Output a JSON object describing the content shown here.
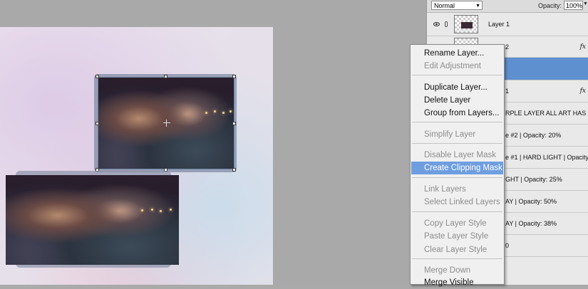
{
  "layers_panel": {
    "blend_mode": "Normal",
    "opacity_label": "Opacity:",
    "opacity_value": "100%",
    "layers": [
      {
        "name": "Layer 1",
        "fx": ""
      },
      {
        "name": "2",
        "fx": "fx"
      },
      {
        "name": "",
        "fx": ""
      },
      {
        "name": "1",
        "fx": "fx"
      },
      {
        "name": "RPLE LAYER ALL ART HAS",
        "fx": ""
      },
      {
        "name": "e #2 | Opacity: 20%",
        "fx": ""
      },
      {
        "name": "e #1 | HARD LIGHT | Opacity 1...",
        "fx": ""
      },
      {
        "name": "GHT | Opacity: 25%",
        "fx": ""
      },
      {
        "name": "AY | Opacity: 50%",
        "fx": ""
      },
      {
        "name": "AY | Opacity: 38%",
        "fx": ""
      },
      {
        "name": "0",
        "fx": ""
      }
    ]
  },
  "context_menu": {
    "items": [
      {
        "label": "Rename Layer...",
        "state": "enabled"
      },
      {
        "label": "Edit Adjustment",
        "state": "disabled"
      },
      {
        "label": "Duplicate Layer...",
        "state": "enabled"
      },
      {
        "label": "Delete Layer",
        "state": "enabled"
      },
      {
        "label": "Group from Layers...",
        "state": "enabled"
      },
      {
        "label": "Simplify Layer",
        "state": "disabled"
      },
      {
        "label": "Disable Layer Mask",
        "state": "disabled"
      },
      {
        "label": "Create Clipping Mask",
        "state": "highlighted"
      },
      {
        "label": "Link Layers",
        "state": "disabled"
      },
      {
        "label": "Select Linked Layers",
        "state": "disabled"
      },
      {
        "label": "Copy Layer Style",
        "state": "disabled"
      },
      {
        "label": "Paste Layer Style",
        "state": "disabled"
      },
      {
        "label": "Clear Layer Style",
        "state": "disabled"
      },
      {
        "label": "Merge Down",
        "state": "disabled"
      },
      {
        "label": "Merge Visible",
        "state": "enabled"
      }
    ]
  },
  "colors": {
    "selection_highlight": "#6f9ee0",
    "selected_layer": "#5e8fcf"
  },
  "icons": [
    "eye-icon",
    "chain-icon",
    "fx-icon",
    "dropdown-arrow-icon",
    "transform-handle-icon",
    "crosshair-icon"
  ]
}
